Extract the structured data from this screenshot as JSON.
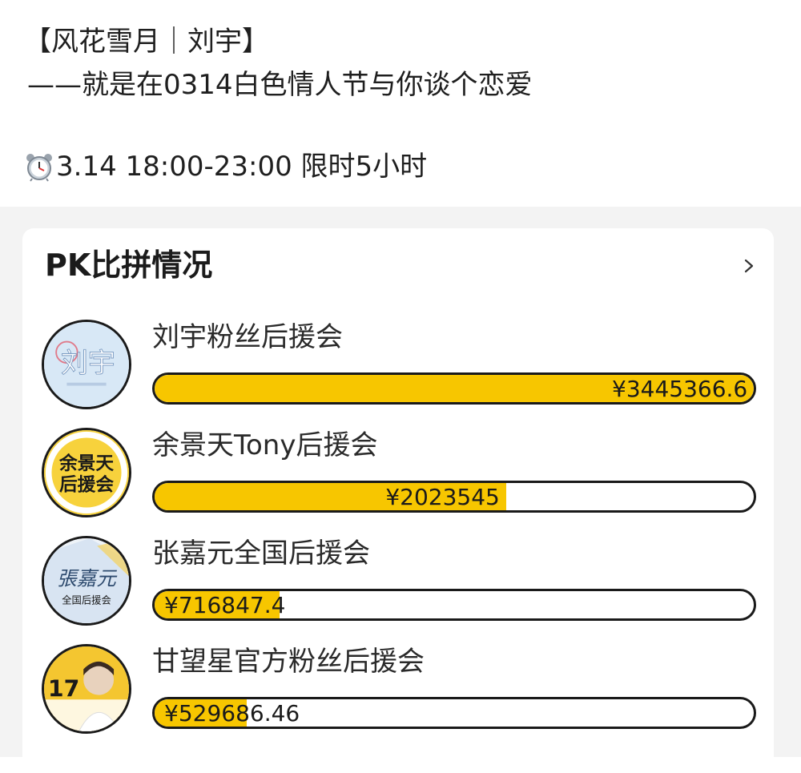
{
  "post": {
    "line1": "【风花雪月｜刘宇】",
    "line2": "——就是在0314白色情人节与你谈个恋爱",
    "time_icon": "alarm-clock-icon",
    "time_text": "3.14 18:00-23:00 限时5小时"
  },
  "pk": {
    "title": "PK比拼情况",
    "more_icon": "chevron-right-icon",
    "bar_color": "#f7c600",
    "items": [
      {
        "name": "刘宇粉丝后援会",
        "amount": "¥3445366.6",
        "value": 3445366.6,
        "avatar_text": "刘宇",
        "avatar_bg": "#d8e8f6"
      },
      {
        "name": "余景天Tony后援会",
        "amount": "¥2023545",
        "value": 2023545,
        "avatar_text_top": "余景天",
        "avatar_text_bottom": "后援会",
        "avatar_bg": "#f7d23c"
      },
      {
        "name": "张嘉元全国后援会",
        "amount": "¥716847.4",
        "value": 716847.4,
        "avatar_text": "張嘉元",
        "avatar_sub": "全国后援会",
        "avatar_bg": "#eef3f8"
      },
      {
        "name": "甘望星官方粉丝后援会",
        "amount": "¥529686.46",
        "value": 529686.46,
        "avatar_text": "17",
        "avatar_bg": "#f4c630"
      }
    ]
  }
}
